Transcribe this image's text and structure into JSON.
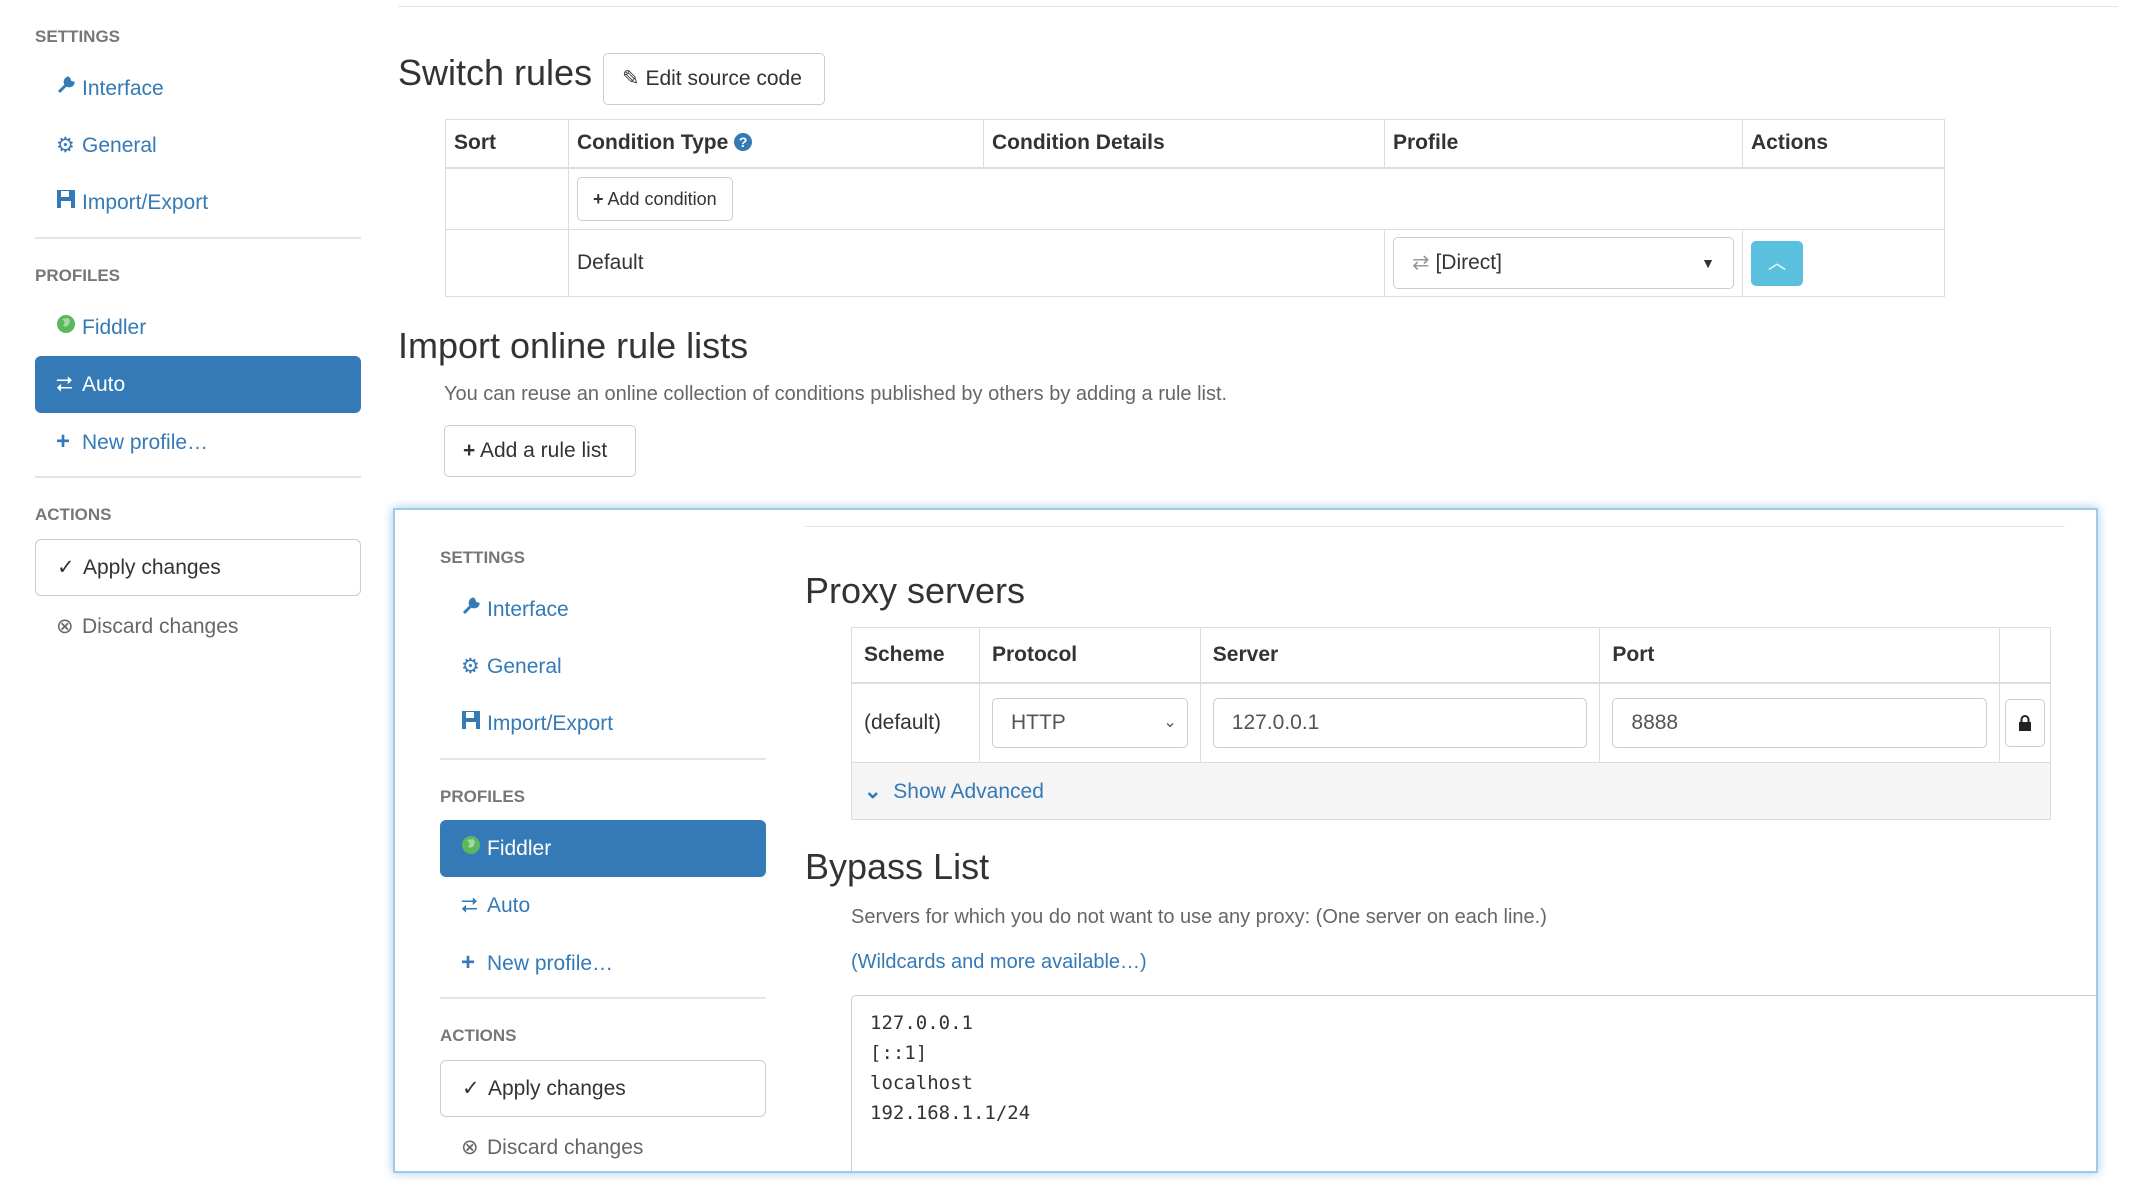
{
  "sidebar": {
    "settings_header": "SETTINGS",
    "settings_items": [
      {
        "label": "Interface",
        "icon": "wrench-icon"
      },
      {
        "label": "General",
        "icon": "gear-icon"
      },
      {
        "label": "Import/Export",
        "icon": "floppy-icon"
      }
    ],
    "profiles_header": "PROFILES",
    "profiles_items": [
      {
        "label": "Fiddler",
        "icon": "globe-icon",
        "active": false
      },
      {
        "label": "Auto",
        "icon": "switch-icon",
        "active": true
      },
      {
        "label": "New profile…",
        "icon": "plus-icon"
      }
    ],
    "actions_header": "ACTIONS",
    "apply_label": "Apply changes",
    "discard_label": "Discard changes"
  },
  "switch_rules": {
    "title": "Switch rules",
    "edit_source_label": "Edit source code",
    "columns": [
      "Sort",
      "Condition Type",
      "Condition Details",
      "Profile",
      "Actions"
    ],
    "add_condition_label": "Add condition",
    "default_row": {
      "condition": "Default",
      "profile": "[Direct]"
    }
  },
  "import_rules": {
    "title": "Import online rule lists",
    "description": "You can reuse an online collection of conditions published by others by adding a rule list.",
    "add_rule_list_label": "Add a rule list"
  },
  "overlay": {
    "sidebar": {
      "settings_header": "SETTINGS",
      "settings_items": [
        {
          "label": "Interface"
        },
        {
          "label": "General"
        },
        {
          "label": "Import/Export"
        }
      ],
      "profiles_header": "PROFILES",
      "profiles_items": [
        {
          "label": "Fiddler",
          "active": true
        },
        {
          "label": "Auto",
          "active": false
        },
        {
          "label": "New profile…"
        }
      ],
      "actions_header": "ACTIONS",
      "apply_label": "Apply changes",
      "discard_label": "Discard changes"
    },
    "proxy": {
      "title": "Proxy servers",
      "columns": [
        "Scheme",
        "Protocol",
        "Server",
        "Port"
      ],
      "row": {
        "scheme": "(default)",
        "protocol": "HTTP",
        "server": "127.0.0.1",
        "port": "8888"
      },
      "show_advanced_label": "Show Advanced"
    },
    "bypass": {
      "title": "Bypass List",
      "description": "Servers for which you do not want to use any proxy: (One server on each line.)",
      "wildcards_link": "(Wildcards and more available…)",
      "entries": "127.0.0.1\n[::1]\nlocalhost\n192.168.1.1/24"
    }
  },
  "colors": {
    "accent": "#337ab7",
    "info_button": "#5bc0de",
    "highlight_border": "#9ecaed",
    "success_icon": "#5cb85c"
  }
}
